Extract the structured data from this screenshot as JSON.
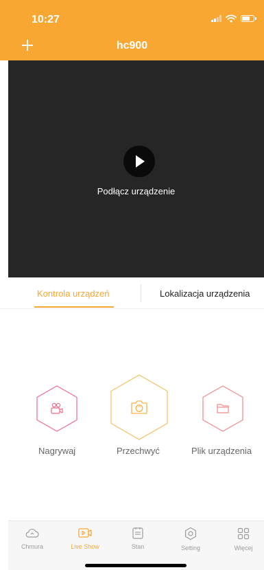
{
  "status": {
    "time": "10:27"
  },
  "header": {
    "title": "hc900"
  },
  "video": {
    "connect_text": "Podłącz urządzenie"
  },
  "tabs": [
    {
      "label": "Kontrola urządzeń",
      "active": true
    },
    {
      "label": "Lokalizacja urządzenia",
      "active": false
    }
  ],
  "actions": [
    {
      "label": "Nagrywaj",
      "icon": "video-camera-icon"
    },
    {
      "label": "Przechwyć",
      "icon": "camera-icon"
    },
    {
      "label": "Plik urządzenia",
      "icon": "folder-icon"
    }
  ],
  "bottom_nav": [
    {
      "label": "Chmura",
      "icon": "cloud-icon",
      "active": false
    },
    {
      "label": "Live Show",
      "icon": "live-show-icon",
      "active": true
    },
    {
      "label": "Stan",
      "icon": "status-icon",
      "active": false
    },
    {
      "label": "Setting",
      "icon": "gear-icon",
      "active": false
    },
    {
      "label": "Więcej",
      "icon": "grid-icon",
      "active": false
    }
  ],
  "colors": {
    "accent": "#f8a733",
    "video_bg": "#262626",
    "record_pink": "#f06b8a",
    "capture_orange": "#f5c066",
    "file_pink": "#ee8a8a"
  }
}
